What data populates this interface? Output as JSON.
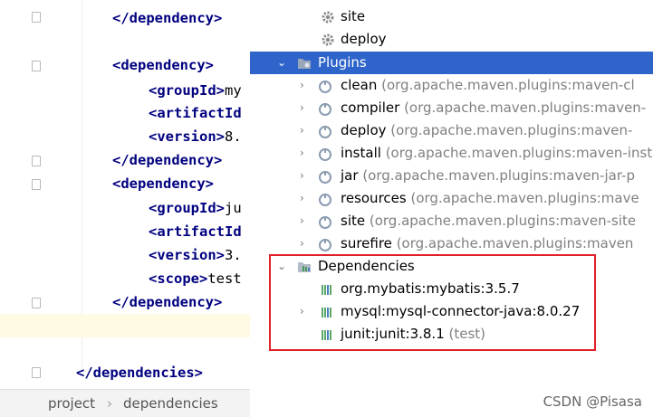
{
  "editor": {
    "lines": [
      {
        "indent": "",
        "text": "</dependency>"
      },
      {
        "indent": "",
        "text": "<dependency>"
      },
      {
        "indent": "    ",
        "text": "<groupId>my"
      },
      {
        "indent": "    ",
        "text": "<artifactId"
      },
      {
        "indent": "    ",
        "text": "<version>8."
      },
      {
        "indent": "",
        "text": "</dependency>"
      },
      {
        "indent": "",
        "text": "<dependency>"
      },
      {
        "indent": "    ",
        "text": "<groupId>ju"
      },
      {
        "indent": "    ",
        "text": "<artifactId"
      },
      {
        "indent": "    ",
        "text": "<version>3."
      },
      {
        "indent": "    ",
        "text": "<scope>test"
      },
      {
        "indent": "",
        "text": "</dependency>"
      },
      {
        "indent": "",
        "text": "</dependencies>"
      }
    ]
  },
  "breadcrumb": {
    "first": "project",
    "separator": "›",
    "second": "dependencies"
  },
  "tree": {
    "lifecycle": [
      {
        "label": "site"
      },
      {
        "label": "deploy"
      }
    ],
    "plugins_label": "Plugins",
    "plugins": [
      {
        "name": "clean",
        "detail": "(org.apache.maven.plugins:maven-cl"
      },
      {
        "name": "compiler",
        "detail": "(org.apache.maven.plugins:maven-"
      },
      {
        "name": "deploy",
        "detail": "(org.apache.maven.plugins:maven-"
      },
      {
        "name": "install",
        "detail": "(org.apache.maven.plugins:maven-install-"
      },
      {
        "name": "jar",
        "detail": "(org.apache.maven.plugins:maven-jar-p"
      },
      {
        "name": "resources",
        "detail": "(org.apache.maven.plugins:mave"
      },
      {
        "name": "site",
        "detail": "(org.apache.maven.plugins:maven-site"
      },
      {
        "name": "surefire",
        "detail": "(org.apache.maven.plugins:maven"
      }
    ],
    "dependencies_label": "Dependencies",
    "dependencies": [
      {
        "name": "org.mybatis:mybatis:3.5.7",
        "scope": ""
      },
      {
        "name": "mysql:mysql-connector-java:8.0.27",
        "scope": ""
      },
      {
        "name": "junit:junit:3.8.1",
        "scope": "(test)"
      }
    ]
  },
  "watermark": "CSDN @Pisasa",
  "colors": {
    "selection": "#2f65ca",
    "highlight_box": "#e0202a",
    "tag": "#000080"
  }
}
